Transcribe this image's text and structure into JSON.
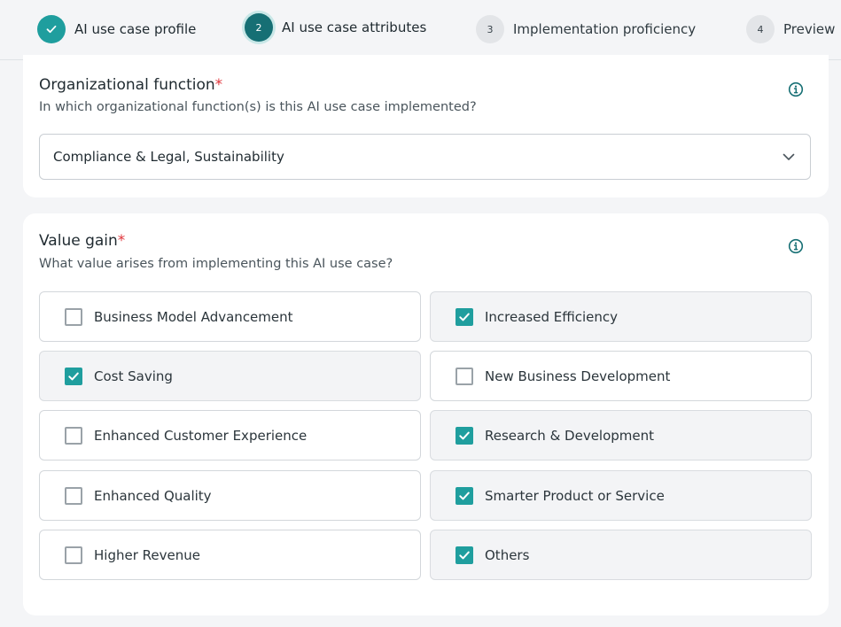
{
  "stepper": {
    "steps": [
      {
        "number": "",
        "label": "AI use case profile",
        "state": "done",
        "icon": "check-icon"
      },
      {
        "number": "2",
        "label": "AI use case attributes",
        "state": "active"
      },
      {
        "number": "3",
        "label": "Implementation proficiency",
        "state": "todo"
      },
      {
        "number": "4",
        "label": "Preview",
        "state": "todo"
      }
    ]
  },
  "organizational_function": {
    "title": "Organizational function",
    "required_mark": "*",
    "subtitle": "In which organizational function(s) is this AI use case implemented?",
    "selected_value": "Compliance & Legal, Sustainability",
    "info_icon": "info-icon",
    "dropdown_icon": "chevron-down-icon"
  },
  "value_gain": {
    "title": "Value gain",
    "required_mark": "*",
    "subtitle": "What value arises from implementing this AI use case?",
    "info_icon": "info-icon",
    "options": [
      {
        "label": "Business Model Advancement",
        "checked": false
      },
      {
        "label": "Increased Efficiency",
        "checked": true
      },
      {
        "label": "Cost Saving",
        "checked": true
      },
      {
        "label": "New Business Development",
        "checked": false
      },
      {
        "label": "Enhanced Customer Experience",
        "checked": false
      },
      {
        "label": "Research & Development",
        "checked": true
      },
      {
        "label": "Enhanced Quality",
        "checked": false
      },
      {
        "label": "Smarter Product or Service",
        "checked": true
      },
      {
        "label": "Higher Revenue",
        "checked": false
      },
      {
        "label": "Others",
        "checked": true
      }
    ]
  },
  "colors": {
    "accent": "#1f9e9e",
    "active_step": "#166f74",
    "required": "#e0353b"
  }
}
